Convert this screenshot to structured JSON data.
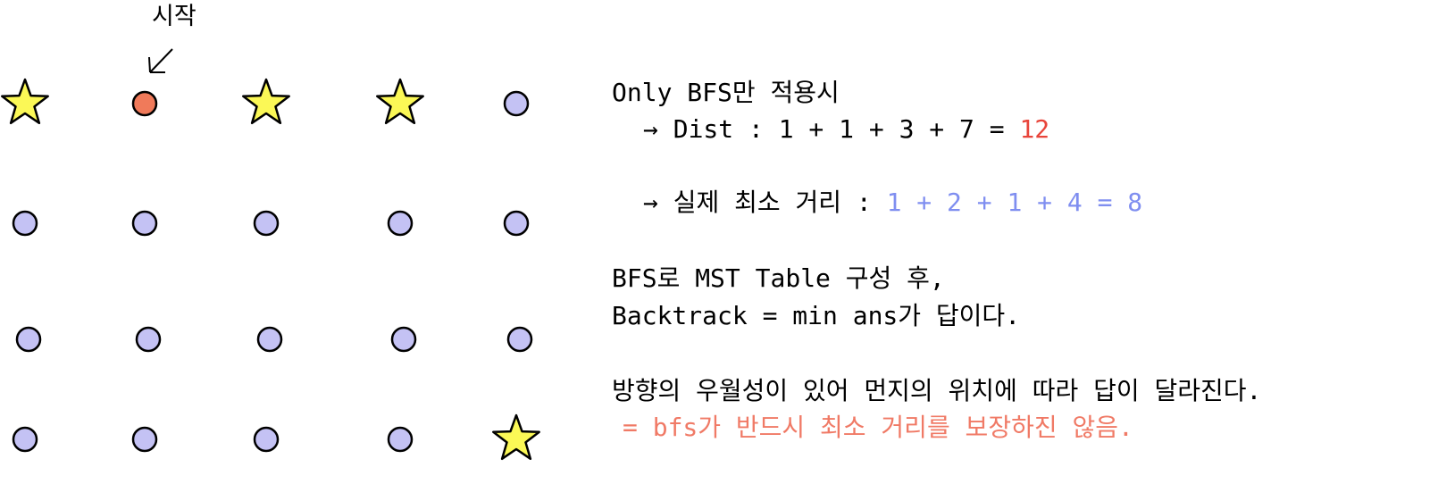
{
  "start_label": "시작",
  "colors": {
    "start": "#f07a5a",
    "node": "#c4c2f4",
    "star": "#fbf856",
    "stroke": "#000000",
    "dist_value": "#e8443a",
    "actual_value": "#7f8ef0",
    "conclusion": "#f07a66"
  },
  "grid": {
    "rows": [
      [
        "star",
        "start",
        "star",
        "star",
        "node"
      ],
      [
        "node",
        "node",
        "node",
        "node",
        "node"
      ],
      [
        "node",
        "node",
        "node",
        "node",
        "node"
      ],
      [
        "node",
        "node",
        "node",
        "node",
        "star"
      ]
    ]
  },
  "notes": {
    "bfs_only_heading": "Only BFS만 적용시",
    "dist_prefix": "→ Dist : 1 + 1 + 3 + 7 = ",
    "dist_value": "12",
    "actual_prefix": "→ 실제 최소 거리 : ",
    "actual_value": "1 + 2 + 1 + 4 = 8",
    "mst_line": "BFS로 MST Table 구성 후,",
    "backtrack_line": "Backtrack = min ans가 답이다.",
    "direction_line": "방향의 우월성이 있어 먼지의 위치에 따라 답이 달라진다.",
    "conclusion_line": "= bfs가 반드시 최소 거리를 보장하진 않음."
  }
}
